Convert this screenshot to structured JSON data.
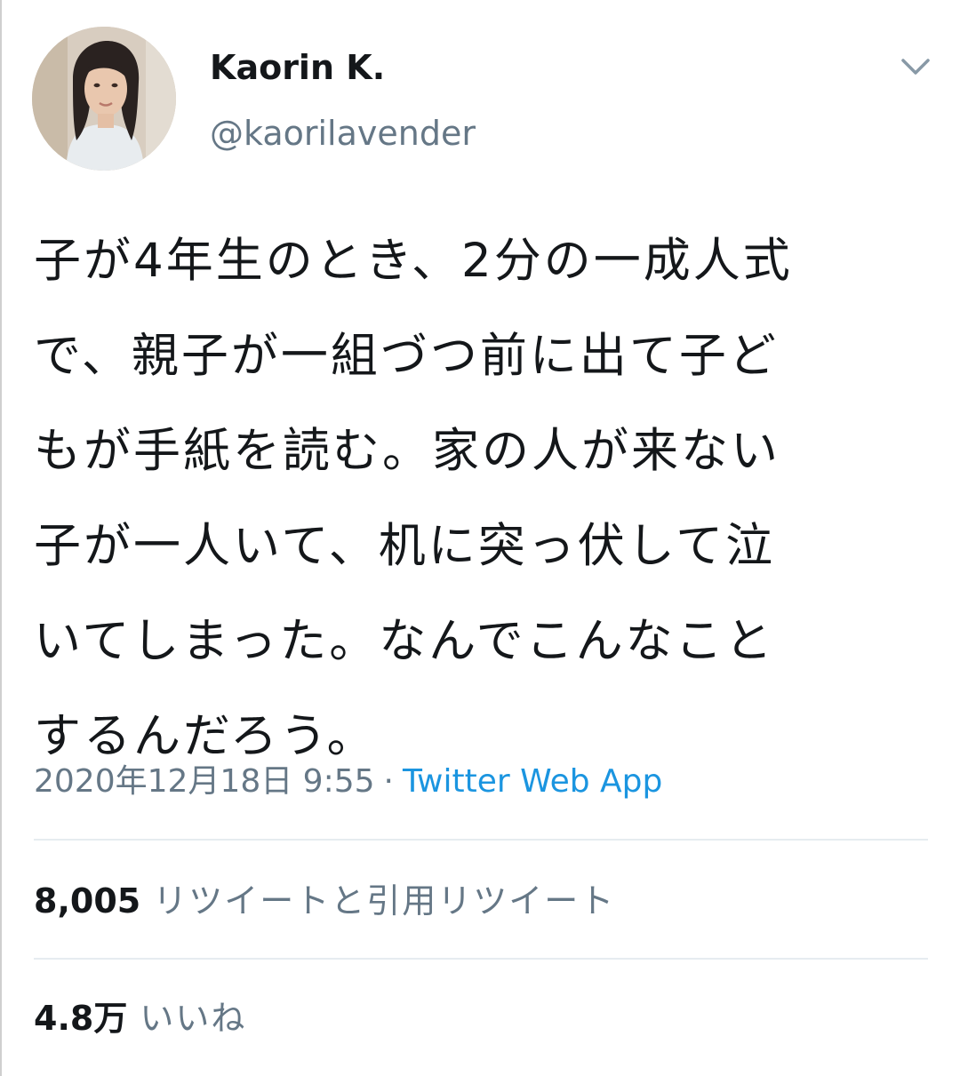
{
  "tweet": {
    "display_name": "Kaorin K.",
    "handle": "@kaorilavender",
    "text_lines": [
      "子が4年生のとき、2分の一成人式",
      "で、親子が一組づつ前に出て子ど",
      "もが手紙を読む。家の人が来ない",
      "子が一人いて、机に突っ伏して泣",
      "いてしまった。なんでこんなこと",
      "するんだろう。"
    ],
    "timestamp": "2020年12月18日 9:55",
    "separator": "·",
    "source": "Twitter Web App",
    "stats": {
      "retweets": {
        "count": "8,005",
        "label": "リツイートと引用リツイート"
      },
      "likes": {
        "count": "4.8万",
        "label": "いいね"
      }
    }
  },
  "icons": {
    "caret": "chevron-down-icon",
    "avatar": "user-avatar"
  },
  "colors": {
    "text_primary": "#14171a",
    "text_secondary": "#657786",
    "link": "#1b95e0",
    "divider": "#e6ecf0"
  }
}
